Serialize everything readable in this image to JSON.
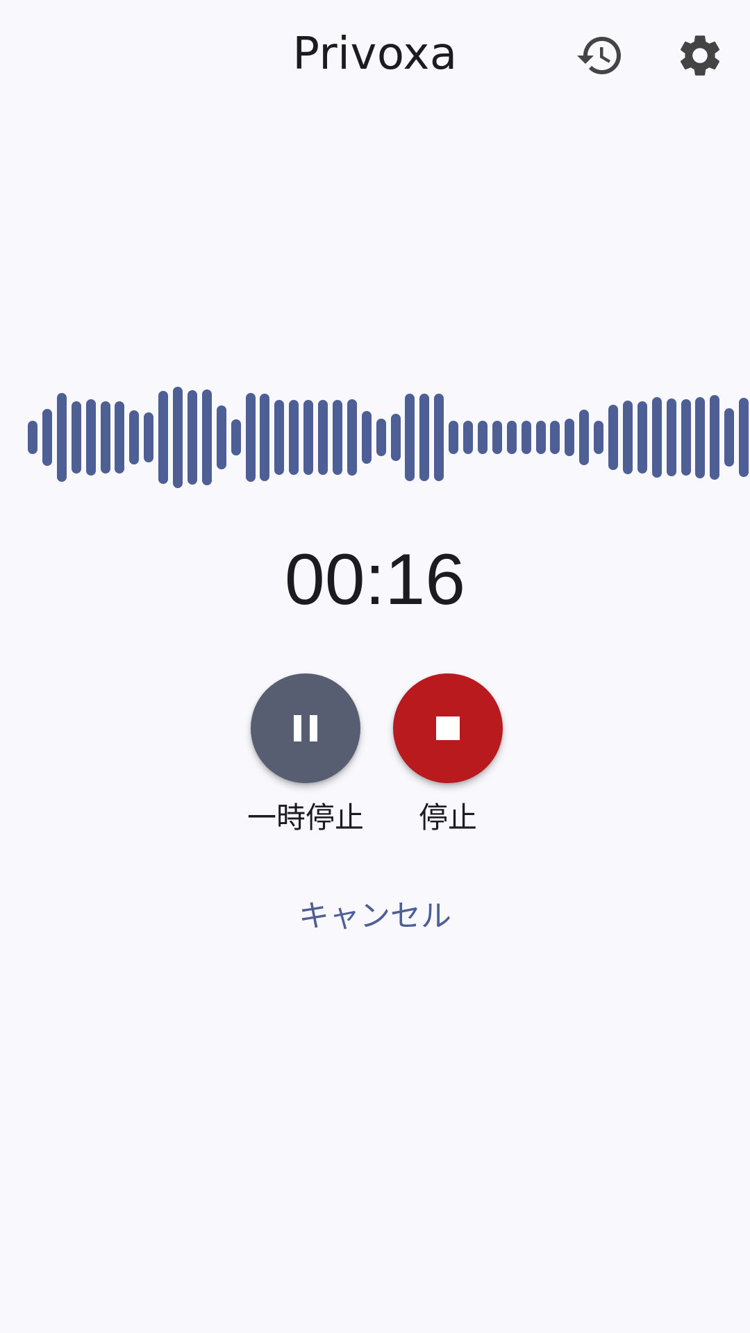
{
  "app": {
    "title": "Privoxa"
  },
  "toolbar": {
    "history_icon": "history-icon",
    "settings_icon": "gear-icon",
    "icon_color": "#444444"
  },
  "recording": {
    "elapsed": "00:16",
    "waveform_color": "#4e5f96",
    "waveform_levels": [
      0.27,
      0.46,
      0.71,
      0.58,
      0.61,
      0.58,
      0.58,
      0.43,
      0.4,
      0.74,
      0.81,
      0.76,
      0.77,
      0.51,
      0.29,
      0.71,
      0.7,
      0.6,
      0.6,
      0.6,
      0.6,
      0.6,
      0.61,
      0.42,
      0.3,
      0.38,
      0.7,
      0.7,
      0.7,
      0.27,
      0.27,
      0.27,
      0.27,
      0.27,
      0.27,
      0.27,
      0.27,
      0.3,
      0.44,
      0.27,
      0.52,
      0.59,
      0.58,
      0.64,
      0.62,
      0.61,
      0.65,
      0.68,
      0.47,
      0.63
    ]
  },
  "controls": {
    "pause": {
      "label": "一時停止",
      "icon": "pause-icon",
      "color": "#575e71"
    },
    "stop": {
      "label": "停止",
      "icon": "stop-icon",
      "color": "#b91a1d"
    }
  },
  "cancel": {
    "label": "キャンセル",
    "color": "#4e5f96"
  }
}
